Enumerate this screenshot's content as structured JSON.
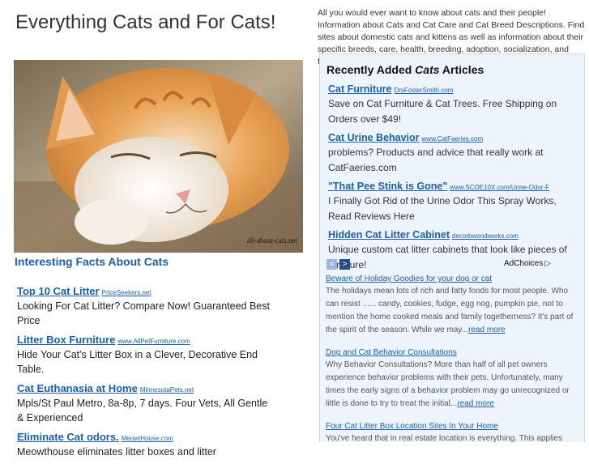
{
  "header": {
    "title": "Everything Cats and For Cats!",
    "intro": "All you would ever want to know about cats and their people! Information about Cats and Cat Care and Cat Breed Descriptions. Find sites about domestic cats and kittens as well as information about their specific breeds, care, health, breeding, adoption, socialization, and feeding."
  },
  "photo": {
    "watermark": "all-about-cats.net"
  },
  "facts": {
    "heading": "Interesting Facts About Cats",
    "ads": [
      {
        "title": "Top 10 Cat Litter",
        "domain": "PriceSeekers.net",
        "desc": "Looking For Cat Litter? Compare Now! Guaranteed Best Price"
      },
      {
        "title": "Litter Box Furniture",
        "domain": "www.AllPetFurniture.com",
        "desc": "Hide Your Cat's Litter Box in a Clever, Decorative End Table."
      },
      {
        "title": "Cat Euthanasia at Home",
        "domain": "MinnesotaPets.net",
        "desc": "Mpls/St Paul Metro, 8a-8p, 7 days. Four Vets, All Gentle & Experienced"
      },
      {
        "title": "Eliminate Cat odors.",
        "domain": "MeowtHouse.com",
        "desc": "Meowthouse eliminates litter boxes and litter"
      }
    ]
  },
  "recent": {
    "heading_pre": "Recently Added ",
    "heading_em": "Cats",
    "heading_post": " Articles",
    "ads": [
      {
        "title": "Cat Furniture",
        "domain": "DrsFosterSmith.com",
        "desc": "Save on Cat Furniture & Cat Trees. Free Shipping on Orders over $49!"
      },
      {
        "title": "Cat Urine Behavior",
        "domain": "www.CatFaeries.com",
        "desc": "problems? Products and advice that really work at CatFaeries.com"
      },
      {
        "title": "\"That Pee Stink is Gone\"",
        "domain": "www.SCOE10X.com/Urine-Odor-F",
        "desc": "I Finally Got Rid of the Urine Odor This Spray Works, Read Reviews Here"
      },
      {
        "title": "Hidden Cat Litter Cabinet",
        "domain": "decorbwoodworks.com",
        "desc": "Unique custom cat litter cabinets that look like pieces of furniture!"
      }
    ],
    "adchoices": "AdChoices",
    "nav_prev": "<",
    "nav_next": ">",
    "articles": [
      {
        "title": "Beware of Holiday Goodies for your dog or cat",
        "body": "The holidays mean lots of rich and fatty foods for most people. Who can resist ...... candy, cookies, fudge, egg nog, pumpkin pie, not to mention the home cooked meals and family togetherness? It's part of the spirit of the season. While we may...",
        "more": "read more"
      },
      {
        "title": "Dog and Cat Behavior Consultations",
        "body": "Why Behavior Consultations? More than half of all pet owners experience behavior problems with their pets. Unfortunately, many times the early signs of a behavior problem may go unrecognized or little is done to try to treat the initial...",
        "more": "read more"
      },
      {
        "title": "Four Cat Litter Box Location Sites In Your Home",
        "body": "You've heard that in real estate location is everything. This applies equally to your cat's litter box. Successful, consistent cat litter box",
        "more": ""
      }
    ]
  },
  "colors": {
    "link": "#1a5fb4",
    "panel_bg": "#eef4fb"
  },
  "icons": {
    "adchoices": "adchoices-triangle-icon",
    "prev": "chevron-left-icon",
    "next": "chevron-right-icon"
  }
}
